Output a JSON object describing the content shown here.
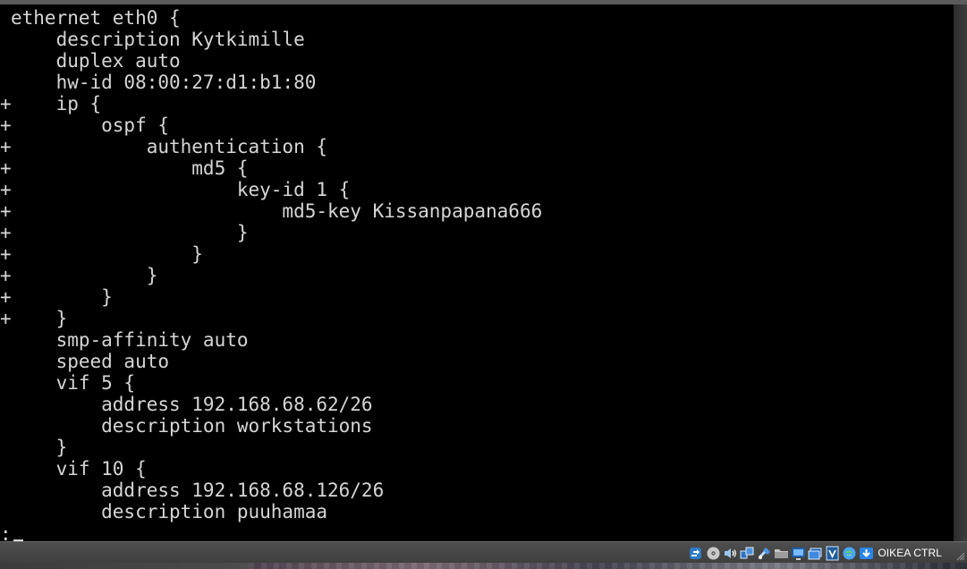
{
  "terminal": {
    "lines": [
      {
        "marker": "",
        "text": "ethernet eth0 {"
      },
      {
        "marker": "",
        "text": "    description Kytkimille"
      },
      {
        "marker": "",
        "text": "    duplex auto"
      },
      {
        "marker": "",
        "text": "    hw-id 08:00:27:d1:b1:80"
      },
      {
        "marker": "+",
        "text": "    ip {"
      },
      {
        "marker": "+",
        "text": "        ospf {"
      },
      {
        "marker": "+",
        "text": "            authentication {"
      },
      {
        "marker": "+",
        "text": "                md5 {"
      },
      {
        "marker": "+",
        "text": "                    key-id 1 {"
      },
      {
        "marker": "+",
        "text": "                        md5-key Kissanpapana666"
      },
      {
        "marker": "+",
        "text": "                    }"
      },
      {
        "marker": "+",
        "text": "                }"
      },
      {
        "marker": "+",
        "text": "            }"
      },
      {
        "marker": "+",
        "text": "        }"
      },
      {
        "marker": "+",
        "text": "    }"
      },
      {
        "marker": "",
        "text": "    smp-affinity auto"
      },
      {
        "marker": "",
        "text": "    speed auto"
      },
      {
        "marker": "",
        "text": "    vif 5 {"
      },
      {
        "marker": "",
        "text": "        address 192.168.68.62/26"
      },
      {
        "marker": "",
        "text": "        description workstations"
      },
      {
        "marker": "",
        "text": "    }"
      },
      {
        "marker": "",
        "text": "    vif 10 {"
      },
      {
        "marker": "",
        "text": "        address 192.168.68.126/26"
      },
      {
        "marker": "",
        "text": "        description puuhamaa"
      }
    ],
    "prompt": ":"
  },
  "status_bar": {
    "icons": [
      "usb-icon",
      "optical-drive-icon",
      "audio-icon",
      "network-icon",
      "usb-device-icon",
      "shared-folder-icon",
      "display-icon",
      "video-capture-icon",
      "virtualization-icon",
      "mouse-integration-icon",
      "keyboard-capture-icon"
    ],
    "host_key": "OIKEA CTRL"
  },
  "colors": {
    "terminal_background": "#000000",
    "terminal_text": "#d6d6d6",
    "status_background": "#4a4a4a",
    "status_text": "#ffffff"
  }
}
